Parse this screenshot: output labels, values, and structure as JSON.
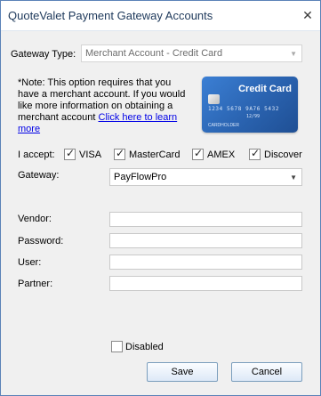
{
  "window": {
    "title": "QuoteValet Payment Gateway Accounts",
    "close_label": "✕"
  },
  "gateway_type": {
    "label": "Gateway Type:",
    "value": "Merchant Account - Credit Card",
    "disabled": true
  },
  "note": {
    "text": "*Note: This option requires that you have a merchant account. If you would like more information on obtaining a merchant account ",
    "link_text": "Click here to learn more"
  },
  "card_image": {
    "title": "Credit Card",
    "number": "1234 5678 9A76 5432",
    "valid": "12/99",
    "holder": "CARDHOLDER"
  },
  "accept": {
    "label": "I accept:",
    "options": [
      {
        "label": "VISA",
        "checked": true
      },
      {
        "label": "MasterCard",
        "checked": true
      },
      {
        "label": "AMEX",
        "checked": true
      },
      {
        "label": "Discover",
        "checked": true
      }
    ]
  },
  "gateway": {
    "label": "Gateway:",
    "value": "PayFlowPro"
  },
  "fields": [
    {
      "label": "Vendor:",
      "value": ""
    },
    {
      "label": "Password:",
      "value": ""
    },
    {
      "label": "User:",
      "value": ""
    },
    {
      "label": "Partner:",
      "value": ""
    }
  ],
  "disabled_option": {
    "label": "Disabled",
    "checked": false
  },
  "buttons": {
    "save": "Save",
    "cancel": "Cancel"
  },
  "colors": {
    "title_text": "#1e395b",
    "link": "#0000e6",
    "card_blue": "#2a63b0",
    "window_border": "#5b82b8"
  }
}
